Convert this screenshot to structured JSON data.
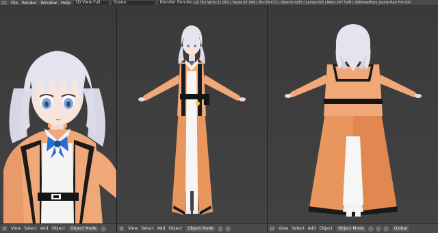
{
  "header": {
    "menus": [
      "File",
      "Render",
      "Window",
      "Help"
    ],
    "screen_layout": "3D View Full",
    "scene": "Scene",
    "render_engine": "Blender Render",
    "stats": "v2.79 | Verts:31,352 | Faces:33,764 | Tris:58,473 | Objects:0/35 | Lamps:0/0 | Mem:267.52M | 000headFace_Raine.Hair.Fm:000"
  },
  "viewports": [
    {
      "menus": [
        "View",
        "Select",
        "Add",
        "Object"
      ],
      "mode": "Object Mode"
    },
    {
      "menus": [
        "View",
        "Select",
        "Add",
        "Object"
      ],
      "mode": "Object Mode"
    },
    {
      "menus": [
        "View",
        "Select",
        "Add",
        "Object"
      ],
      "mode": "Object Mode",
      "pivot": "Global"
    }
  ],
  "colors": {
    "coat_orange": "#f0a878",
    "coat_shadow": "#d88050",
    "black_trim": "#1a1a1a",
    "hair": "#e4e4f0",
    "bow_blue": "#2a6fd0",
    "background": "#3d3d3d"
  }
}
